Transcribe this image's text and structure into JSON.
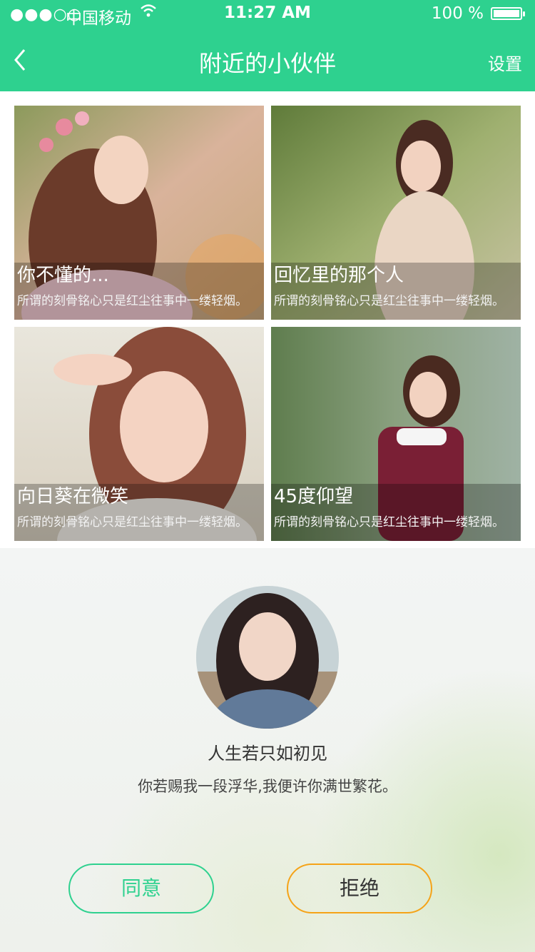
{
  "status_bar": {
    "signal_dots": "●●●○○",
    "carrier": "中国移动",
    "time": "11:27 AM",
    "battery_percent": "100 %",
    "battery_level": 1.0
  },
  "nav": {
    "back_icon": "chevron-left-icon",
    "title": "附近的小伙伴",
    "settings_label": "设置"
  },
  "cards": [
    {
      "title": "你不懂的...",
      "subtitle": "所谓的刻骨铭心只是红尘往事中一缕轻烟。"
    },
    {
      "title": "回忆里的那个人",
      "subtitle": "所谓的刻骨铭心只是红尘往事中一缕轻烟。"
    },
    {
      "title": "向日葵在微笑",
      "subtitle": "所谓的刻骨铭心只是红尘往事中一缕轻烟。"
    },
    {
      "title": "45度仰望",
      "subtitle": "所谓的刻骨铭心只是红尘往事中一缕轻烟。"
    }
  ],
  "modal": {
    "title": "人生若只如初见",
    "message": "你若赐我一段浮华,我便许你满世繁花。",
    "agree_label": "同意",
    "reject_label": "拒绝"
  },
  "colors": {
    "accent": "#2ed18f",
    "reject_border": "#f5a318"
  }
}
